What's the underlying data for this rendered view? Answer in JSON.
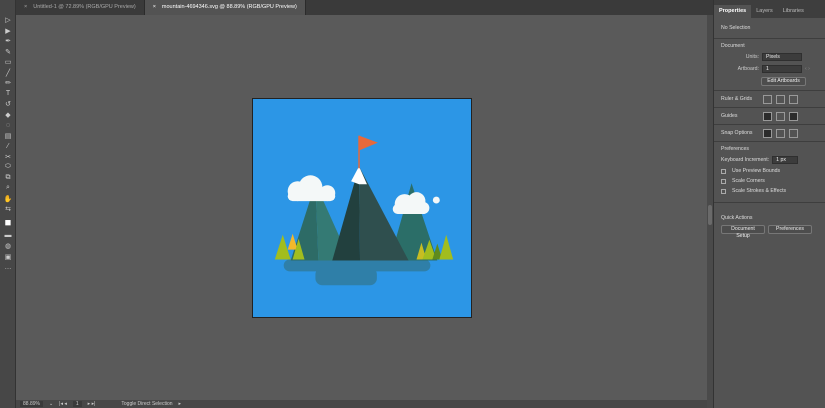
{
  "tabs": [
    {
      "label": "Untitled-1 @ 72.89% (RGB/GPU Preview)",
      "active": false
    },
    {
      "label": "mountain-4694346.svg @ 88.89% (RGB/GPU Preview)",
      "active": true
    }
  ],
  "tools": [
    "selection-icon",
    "direct-selection-icon",
    "pen-icon",
    "curvature-icon",
    "rectangle-icon",
    "paintbrush-icon",
    "pencil-icon",
    "type-icon",
    "rotate-icon",
    "eraser-icon",
    "shape-builder-icon",
    "gradient-icon",
    "eyedropper-icon",
    "blend-icon",
    "symbol-sprayer-icon",
    "artboard-icon",
    "zoom-icon",
    "hand-icon",
    "swap-icon",
    "fill-stroke-icon",
    "color-mode-icon",
    "draw-mode-icon",
    "screen-mode-icon",
    "more-icon"
  ],
  "panel": {
    "tabs": [
      "Properties",
      "Layers",
      "Libraries"
    ],
    "no_selection": "No Selection",
    "document": "Document",
    "units_label": "Units:",
    "units_value": "Pixels",
    "artboard_label": "Artboard:",
    "artboard_value": "1",
    "edit_artboards": "Edit Artboards",
    "ruler_grids": "Ruler & Grids",
    "guides": "Guides",
    "snap_options": "Snap Options",
    "preferences": "Preferences",
    "keyboard_increment_label": "Keyboard Increment:",
    "keyboard_increment_value": "1 px",
    "use_preview_bounds": "Use Preview Bounds",
    "scale_corners": "Scale Corners",
    "scale_strokes": "Scale Strokes & Effects",
    "quick_actions": "Quick Actions",
    "document_setup": "Document Setup",
    "preferences_button": "Preferences"
  },
  "status": {
    "zoom": "88.89%",
    "artboard": "1",
    "tool": "Toggle Direct Selection"
  },
  "colors": {
    "artboard_bg": "#2c96e6",
    "flag": "#e8693a"
  }
}
